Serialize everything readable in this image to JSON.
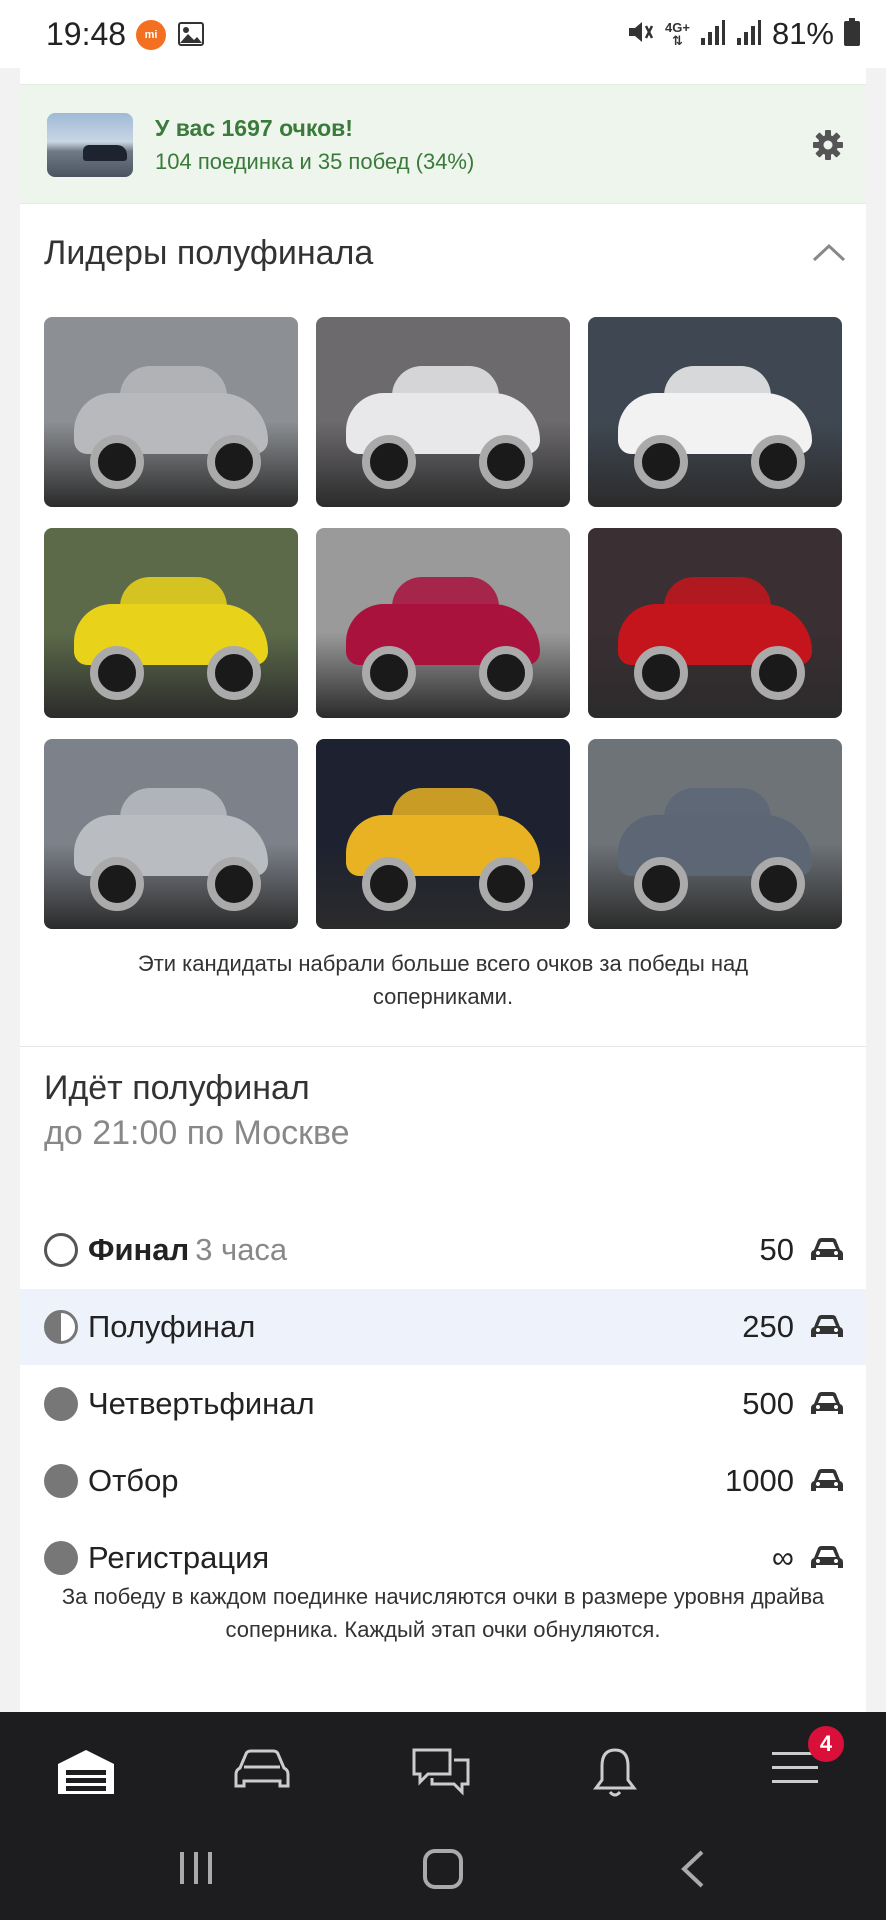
{
  "status_bar": {
    "time": "19:48",
    "mi_label": "mi",
    "network": "4G+",
    "battery": "81%"
  },
  "points": {
    "title": "У вас 1697 очков!",
    "subtitle": "104 поединка и 35 побед (34%)"
  },
  "leaders": {
    "title": "Лидеры полуфинала",
    "note": "Эти кандидаты набрали больше всего очков за победы над соперниками."
  },
  "stage_section": {
    "title": "Идёт полуфинал",
    "deadline": "до 21:00 по Москве",
    "stages": [
      {
        "name": "Финал",
        "duration": "3 часа",
        "value": "50",
        "state": "empty"
      },
      {
        "name": "Полуфинал",
        "duration": "",
        "value": "250",
        "state": "half"
      },
      {
        "name": "Четвертьфинал",
        "duration": "",
        "value": "500",
        "state": "full"
      },
      {
        "name": "Отбор",
        "duration": "",
        "value": "1000",
        "state": "full"
      },
      {
        "name": "Регистрация",
        "duration": "",
        "value": "∞",
        "state": "full"
      }
    ],
    "note": "За победу в каждом поединке начисляются очки в размере уровня драйва соперника. Каждый этап очки обнуляются."
  },
  "bottom_nav": {
    "items": [
      "garage-icon",
      "car-icon",
      "messages-icon",
      "bell-icon",
      "menu-icon"
    ],
    "menu_badge": "4"
  },
  "photos": [
    {
      "bg": "#8c8f93",
      "car": "#b7b9bc"
    },
    {
      "bg": "#6d6a6e",
      "car": "#e8e8ea"
    },
    {
      "bg": "#3f4852",
      "car": "#f2f2f2"
    },
    {
      "bg": "#5c6a4a",
      "car": "#e9d21a"
    },
    {
      "bg": "#9a9a9a",
      "car": "#a8123d"
    },
    {
      "bg": "#3a2f33",
      "car": "#c4151c"
    },
    {
      "bg": "#7d828a",
      "car": "#b9bcc1"
    },
    {
      "bg": "#1e2230",
      "car": "#e8b223"
    },
    {
      "bg": "#6e7378",
      "car": "#5c6675"
    }
  ]
}
